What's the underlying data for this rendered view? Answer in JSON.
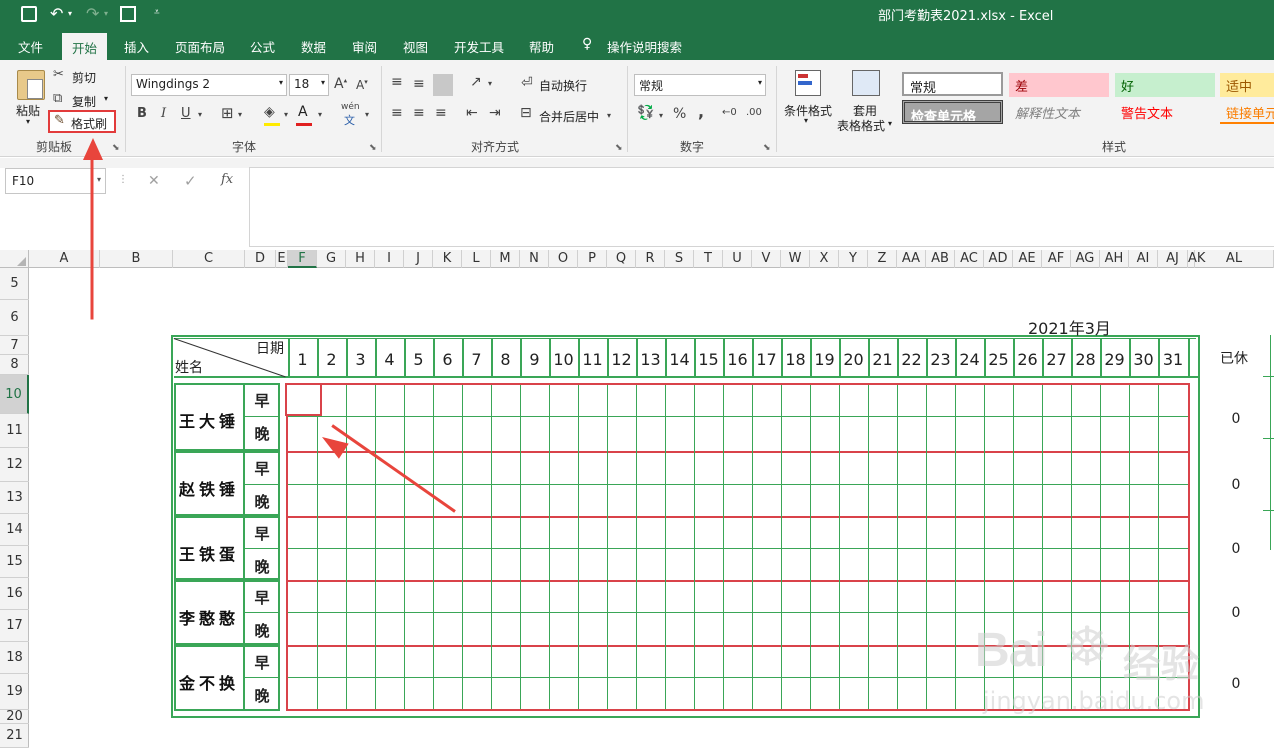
{
  "app": {
    "title": "部门考勤表2021.xlsx  -  Excel"
  },
  "qat": {
    "save_icon": "save-icon",
    "undo_icon": "undo-icon",
    "redo_icon": "redo-icon",
    "form_icon": "form-icon",
    "customize_icon": "chevron-down-icon"
  },
  "tabs": [
    {
      "label": "文件"
    },
    {
      "label": "开始"
    },
    {
      "label": "插入"
    },
    {
      "label": "页面布局"
    },
    {
      "label": "公式"
    },
    {
      "label": "数据"
    },
    {
      "label": "审阅"
    },
    {
      "label": "视图"
    },
    {
      "label": "开发工具"
    },
    {
      "label": "帮助"
    }
  ],
  "tellme": {
    "label": "操作说明搜索"
  },
  "clipboard": {
    "paste": "粘贴",
    "cut": "剪切",
    "copy": "复制",
    "format_painter": "格式刷",
    "group": "剪贴板"
  },
  "font": {
    "name": "Wingdings 2",
    "size": "18",
    "bold": "B",
    "italic": "I",
    "underline": "U",
    "wen": "wén",
    "group": "字体"
  },
  "alignment": {
    "wrap": "自动换行",
    "merge": "合并后居中",
    "group": "对齐方式"
  },
  "number": {
    "format": "常规",
    "percent": "%",
    "comma": ",",
    "group": "数字"
  },
  "styles": {
    "cond": "条件格式",
    "table1": "套用",
    "table2": "表格格式",
    "normal": "常规",
    "bad": "差",
    "good": "好",
    "neutral": "适中",
    "check": "检查单元格",
    "explain": "解释性文本",
    "warning": "警告文本",
    "link": "链接单元",
    "group": "样式"
  },
  "formula": {
    "namebox": "F10",
    "cancel": "✕",
    "enter": "✓",
    "fx": "fx",
    "content": ""
  },
  "columns": [
    "A",
    "B",
    "C",
    "D",
    "E",
    "F",
    "G",
    "H",
    "I",
    "J",
    "K",
    "L",
    "M",
    "N",
    "O",
    "P",
    "Q",
    "R",
    "S",
    "T",
    "U",
    "V",
    "W",
    "X",
    "Y",
    "Z",
    "AA",
    "AB",
    "AC",
    "AD",
    "AE",
    "AF",
    "AG",
    "AH",
    "AI",
    "AJ",
    "AK",
    "AL"
  ],
  "rows": [
    "5",
    "6",
    "7",
    "8",
    "10",
    "11",
    "12",
    "13",
    "14",
    "15",
    "16",
    "17",
    "18",
    "19",
    "20",
    "21"
  ],
  "sheet": {
    "month_title": "2021年3月",
    "date_label": "日期",
    "name_label": "姓名",
    "rest_label": "已休",
    "days": [
      "1",
      "2",
      "3",
      "4",
      "5",
      "6",
      "7",
      "8",
      "9",
      "10",
      "11",
      "12",
      "13",
      "14",
      "15",
      "16",
      "17",
      "18",
      "19",
      "20",
      "21",
      "22",
      "23",
      "24",
      "25",
      "26",
      "27",
      "28",
      "29",
      "30",
      "31"
    ],
    "employees": [
      {
        "name": "王大锤",
        "am": "早",
        "pm": "晚",
        "rest": "0"
      },
      {
        "name": "赵铁锤",
        "am": "早",
        "pm": "晚",
        "rest": "0"
      },
      {
        "name": "王铁蛋",
        "am": "早",
        "pm": "晚",
        "rest": "0"
      },
      {
        "name": "李憨憨",
        "am": "早",
        "pm": "晚",
        "rest": "0"
      },
      {
        "name": "金不换",
        "am": "早",
        "pm": "晚",
        "rest": "0"
      }
    ]
  },
  "watermark": {
    "brand": "Bai",
    "brand2": "经验",
    "url": "jingyan.baidu.com"
  },
  "colors": {
    "excel_green": "#217346",
    "grid_green": "#3aa657",
    "grid_red": "#d9434a",
    "arrow": "#e8453c"
  }
}
